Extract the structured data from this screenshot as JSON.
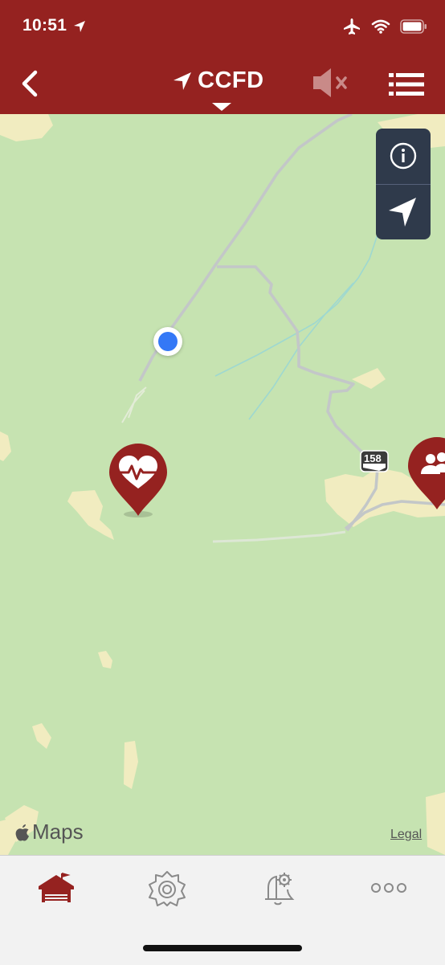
{
  "status_bar": {
    "time": "10:51"
  },
  "nav_bar": {
    "title": "CCFD",
    "back_icon": "chevron-left-icon",
    "mute_icon": "speaker-muted-icon",
    "menu_icon": "list-menu-icon"
  },
  "map": {
    "route_number": "158",
    "attribution": "Maps",
    "legal_label": "Legal",
    "controls": [
      {
        "icon": "info-icon"
      },
      {
        "icon": "location-arrow-icon"
      }
    ],
    "markers": [
      {
        "icon": "heart-pulse-icon"
      },
      {
        "icon": "people-icon"
      }
    ]
  },
  "tab_bar": {
    "tabs": [
      {
        "icon": "home-icon",
        "active": true
      },
      {
        "icon": "fire-emblem-icon",
        "active": false
      },
      {
        "icon": "alert-settings-icon",
        "active": false
      },
      {
        "icon": "more-icon",
        "active": false
      }
    ]
  },
  "colors": {
    "brand": "#952220",
    "map_land": "#c6e3b1",
    "map_sand": "#f1ecc0",
    "control_bg": "#2f3a4b",
    "user_dot": "#3478f6"
  }
}
